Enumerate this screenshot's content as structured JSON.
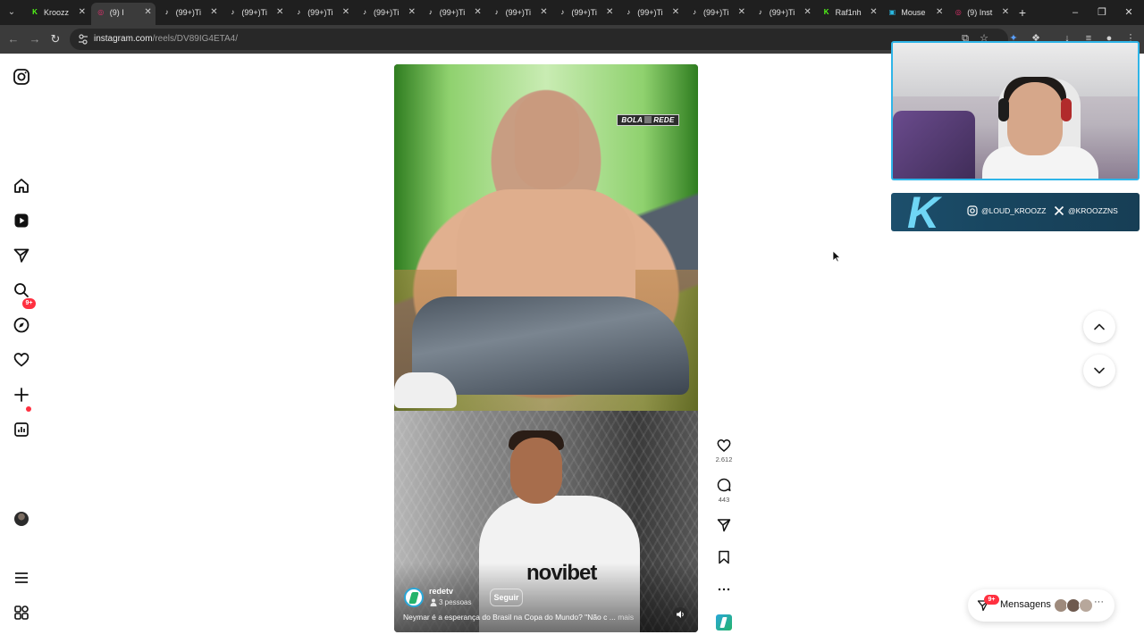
{
  "browser": {
    "tabs": [
      {
        "title": "Kroozz",
        "icon": "kick-icon",
        "color": "#53fc18",
        "active": false
      },
      {
        "title": "(9) I",
        "icon": "instagram-icon",
        "color": "#e1306c",
        "active": true
      },
      {
        "title": "(99+)Ti",
        "icon": "tiktok-icon",
        "color": "#ffffff",
        "active": false
      },
      {
        "title": "(99+)Ti",
        "icon": "tiktok-icon",
        "color": "#ffffff",
        "active": false
      },
      {
        "title": "(99+)Ti",
        "icon": "tiktok-icon",
        "color": "#ffffff",
        "active": false
      },
      {
        "title": "(99+)Ti",
        "icon": "tiktok-icon",
        "color": "#ffffff",
        "active": false
      },
      {
        "title": "(99+)Ti",
        "icon": "tiktok-icon",
        "color": "#ffffff",
        "active": false
      },
      {
        "title": "(99+)Ti",
        "icon": "tiktok-icon",
        "color": "#ffffff",
        "active": false
      },
      {
        "title": "(99+)Ti",
        "icon": "tiktok-icon",
        "color": "#ffffff",
        "active": false
      },
      {
        "title": "(99+)Ti",
        "icon": "tiktok-icon",
        "color": "#ffffff",
        "active": false
      },
      {
        "title": "(99+)Ti",
        "icon": "tiktok-icon",
        "color": "#ffffff",
        "active": false
      },
      {
        "title": "(99+)Ti",
        "icon": "tiktok-icon",
        "color": "#ffffff",
        "active": false
      },
      {
        "title": "Raf1nh",
        "icon": "kick-icon",
        "color": "#53fc18",
        "active": false
      },
      {
        "title": "Mouse",
        "icon": "site-icon",
        "color": "#2ab7e0",
        "active": false
      },
      {
        "title": "(9) Inst",
        "icon": "instagram-icon",
        "color": "#e1306c",
        "active": false
      }
    ],
    "url_host": "instagram.com",
    "url_path": "/reels/DV89IG4ETA4/"
  },
  "reel": {
    "author": "redetv",
    "people_count": "3 pessoas",
    "follow_label": "Seguir",
    "caption": "Neymar é a esperança do Brasil na Copa do Mundo? \"Não c ...",
    "caption_more": "mais",
    "video_logo_left": "BOLA",
    "video_logo_right": "REDE",
    "sponsor_text": "novibet"
  },
  "actions": {
    "likes": "2.612",
    "comments": "443"
  },
  "sidebar": {
    "notifications_badge": "9+"
  },
  "overlay": {
    "instagram_handle": "@LOUD_KROOZZ",
    "x_handle": "@KROOZZNS",
    "brand_letter": "K"
  },
  "messages": {
    "label": "Mensagens",
    "badge": "9+"
  },
  "colors": {
    "accent_red": "#ff3040",
    "overlay_blue": "#2fb5e8"
  }
}
